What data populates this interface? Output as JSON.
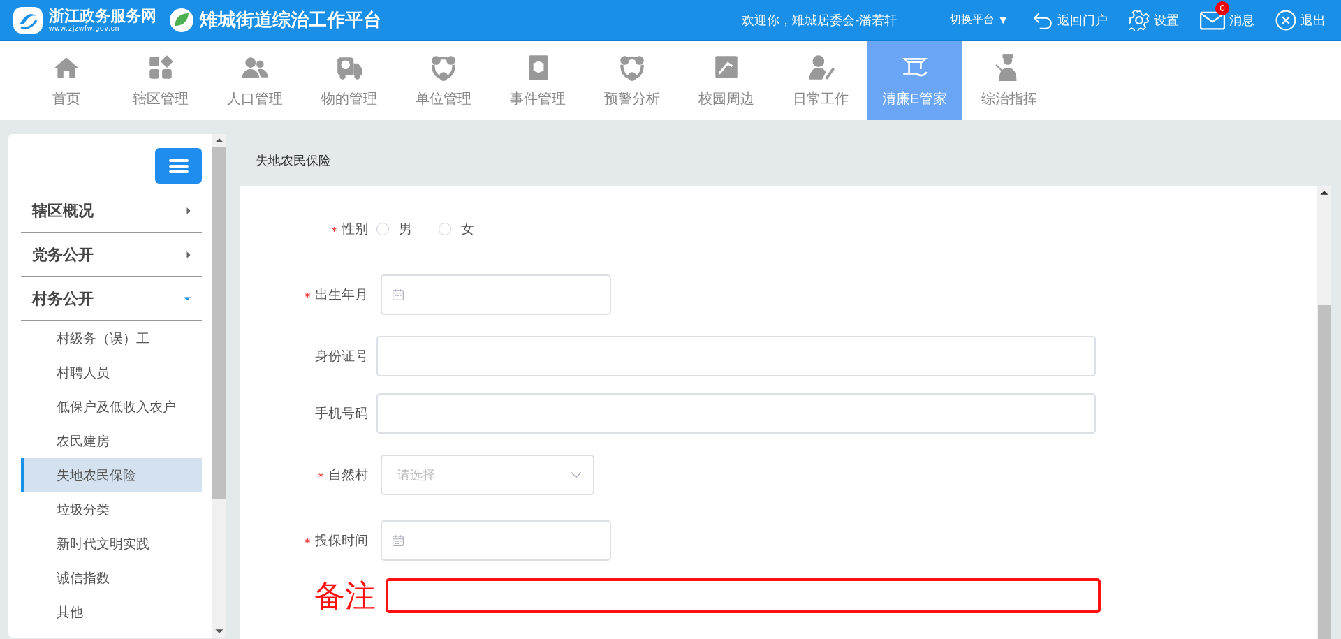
{
  "header": {
    "portal_name": "浙江政务服务网",
    "portal_url": "www.zjzwfw.gov.cn",
    "platform_title": "雉城街道综治工作平台",
    "welcome": "欢迎你，雉城居委会-潘若轩",
    "switch_platform": "切换平台",
    "switch_caret": "▼",
    "actions": [
      {
        "kind": "back",
        "label": "返回门户"
      },
      {
        "kind": "settings",
        "label": "设置"
      },
      {
        "kind": "messages",
        "label": "消息",
        "badge": "0"
      },
      {
        "kind": "exit",
        "label": "退出"
      }
    ]
  },
  "nav": [
    {
      "label": "首页",
      "selected": false
    },
    {
      "label": "辖区管理",
      "selected": false
    },
    {
      "label": "人口管理",
      "selected": false
    },
    {
      "label": "物的管理",
      "selected": false
    },
    {
      "label": "单位管理",
      "selected": false
    },
    {
      "label": "事件管理",
      "selected": false
    },
    {
      "label": "预警分析",
      "selected": false
    },
    {
      "label": "校园周边",
      "selected": false
    },
    {
      "label": "日常工作",
      "selected": false
    },
    {
      "label": "清廉E管家",
      "selected": true
    },
    {
      "label": "综治指挥",
      "selected": false
    }
  ],
  "sidebar": {
    "groups": [
      {
        "label": "辖区概况",
        "expanded": false
      },
      {
        "label": "党务公开",
        "expanded": false
      },
      {
        "label": "村务公开",
        "expanded": true,
        "children": [
          {
            "label": "村级务（误）工",
            "selected": false
          },
          {
            "label": "村聘人员",
            "selected": false
          },
          {
            "label": "低保户及低收入农户",
            "selected": false
          },
          {
            "label": "农民建房",
            "selected": false
          },
          {
            "label": "失地农民保险",
            "selected": true
          },
          {
            "label": "垃圾分类",
            "selected": false
          },
          {
            "label": "新时代文明实践",
            "selected": false
          },
          {
            "label": "诚信指数",
            "selected": false
          },
          {
            "label": "其他",
            "selected": false
          }
        ]
      }
    ]
  },
  "breadcrumb": "失地农民保险",
  "form": {
    "fields": [
      {
        "kind": "radio",
        "label": "性别",
        "required": true,
        "options": [
          {
            "label": "男",
            "selected": false
          },
          {
            "label": "女",
            "selected": false
          }
        ]
      },
      {
        "kind": "date",
        "label": "出生年月",
        "required": true
      },
      {
        "kind": "text",
        "label": "身份证号",
        "required": false
      },
      {
        "kind": "text",
        "label": "手机号码",
        "required": false
      },
      {
        "kind": "select",
        "label": "自然村",
        "required": true,
        "placeholder": "请选择"
      },
      {
        "kind": "date",
        "label": "投保时间",
        "required": true
      },
      {
        "kind": "annotated",
        "label": "备注",
        "required": false
      }
    ]
  }
}
